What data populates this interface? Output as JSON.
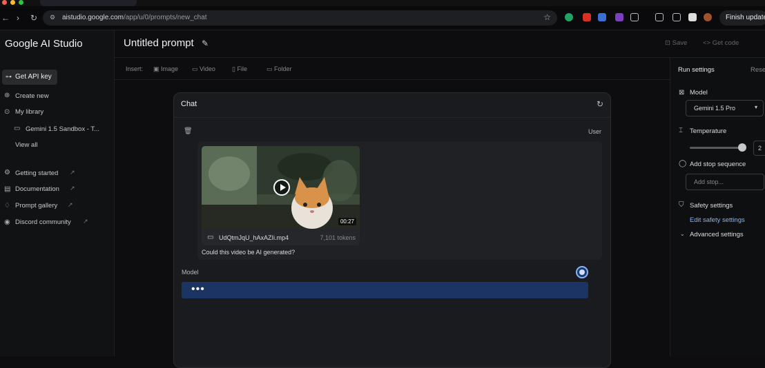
{
  "browser": {
    "url_domain": "aistudio.google.com",
    "url_path": "/app/u/0/prompts/new_chat",
    "finish_update_label": "Finish update"
  },
  "sidebar": {
    "brand": "Google AI Studio",
    "get_api_key": "Get API key",
    "items": [
      {
        "label": "Create new",
        "icon": "plus-circle-icon"
      },
      {
        "label": "My library",
        "icon": "person-icon"
      },
      {
        "label": "Gemini 1.5 Sandbox - T...",
        "icon": "chat-icon"
      },
      {
        "label": "View all",
        "icon": ""
      },
      {
        "label": "Getting started",
        "icon": "gear-icon"
      },
      {
        "label": "Documentation",
        "icon": "document-icon"
      },
      {
        "label": "Prompt gallery",
        "icon": "bulb-icon"
      },
      {
        "label": "Discord community",
        "icon": "discord-icon"
      }
    ]
  },
  "header": {
    "title": "Untitled prompt",
    "save_label": "Save",
    "get_code_label": "Get code"
  },
  "insert_bar": {
    "label": "Insert:",
    "image": "Image",
    "video": "Video",
    "file": "File",
    "folder": "Folder"
  },
  "run_settings": {
    "title": "Run settings",
    "reset": "Rese",
    "model_label": "Model",
    "model_value": "Gemini 1.5 Pro",
    "temperature_label": "Temperature",
    "temperature_value": "2",
    "temperature_fraction": 0.95,
    "stop_sequence_label": "Add stop sequence",
    "stop_placeholder": "Add stop...",
    "safety_label": "Safety settings",
    "edit_safety_label": "Edit safety settings",
    "advanced_label": "Advanced settings"
  },
  "chat": {
    "title": "Chat",
    "user_label": "User",
    "video_filename": "UdQtmJqU_hAxAZIi.mp4",
    "video_tokens": "7,101 tokens",
    "video_duration": "00:27",
    "prompt_text": "Could this video be AI generated?",
    "model_label": "Model",
    "typing_dots": "•••"
  }
}
